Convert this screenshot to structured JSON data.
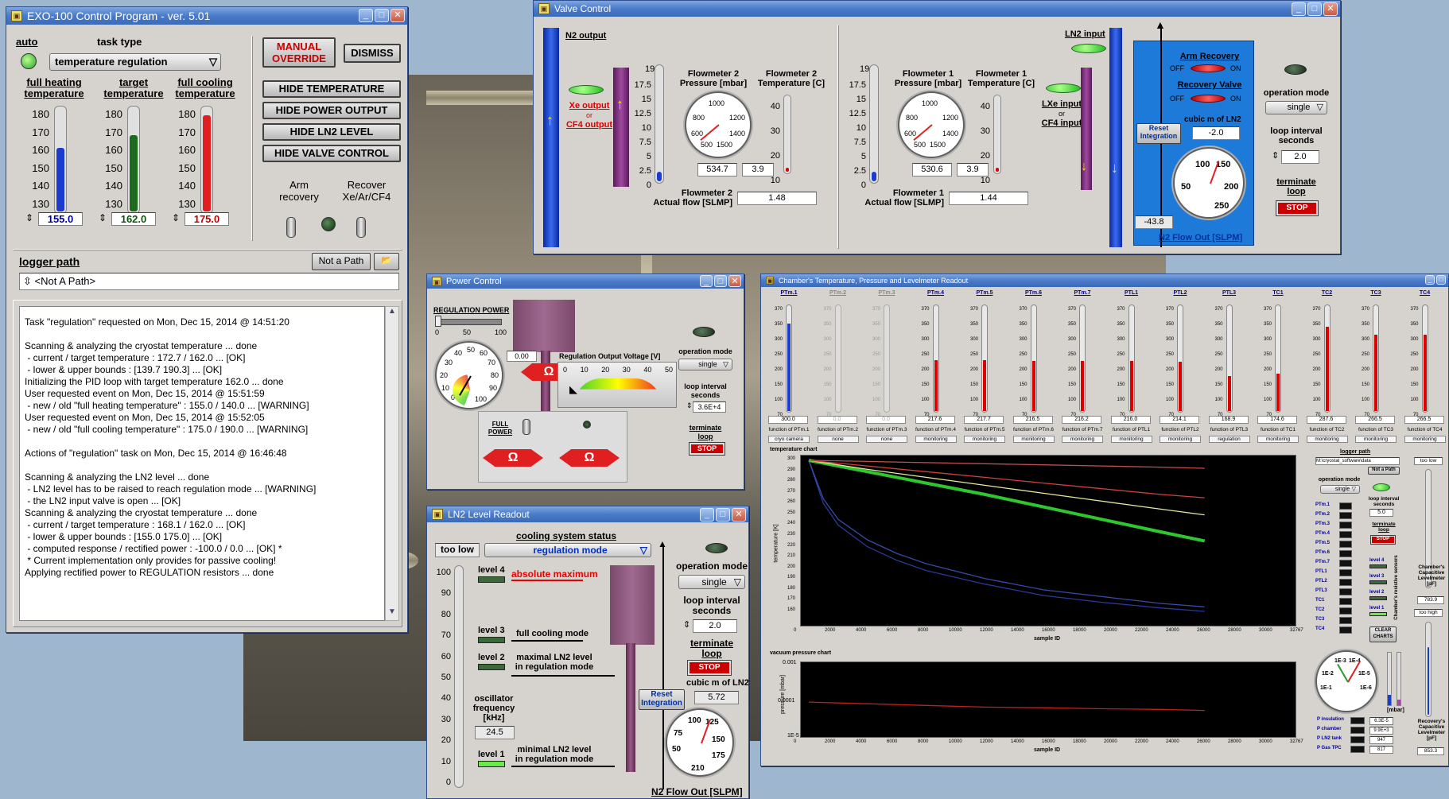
{
  "exo": {
    "title": "EXO-100 Control Program - ver. 5.01",
    "auto_label": "auto",
    "task_type_label": "task type",
    "task_type_value": "temperature regulation",
    "manual_override": "MANUAL\nOVERRIDE",
    "dismiss": "DISMISS",
    "hide_temperature": "HIDE TEMPERATURE",
    "hide_power": "HIDE POWER OUTPUT",
    "hide_ln2": "HIDE LN2 LEVEL",
    "hide_valve": "HIDE VALVE CONTROL",
    "full_heating_label": "full heating\ntemperature",
    "target_label": "target\ntemperature",
    "full_cooling_label": "full cooling\ntemperature",
    "scale": [
      "180",
      "170",
      "160",
      "150",
      "140",
      "130"
    ],
    "full_heating_value": "155.0",
    "target_value": "162.0",
    "full_cooling_value": "175.0",
    "arm_recovery": "Arm\nrecovery",
    "recover_label": "Recover\nXe/Ar/CF4",
    "logger_path_label": "logger path",
    "not_a_path_btn": "Not a Path",
    "logger_path_value": "<Not A Path>",
    "log": "Task \"regulation\" requested on Mon, Dec 15, 2014 @ 14:51:20\n\nScanning & analyzing the cryostat temperature ... done\n - current / target temperature : 172.7 / 162.0 ... [OK]\n - lower & upper bounds : [139.7 190.3] ... [OK]\nInitializing the PID loop with target temperature 162.0 ... done\nUser requested event on Mon, Dec 15, 2014 @ 15:51:59\n - new / old \"full heating temperature\" : 155.0 / 140.0 ... [WARNING]\nUser requested event on Mon, Dec 15, 2014 @ 15:52:05\n - new / old \"full cooling temperature\" : 175.0 / 190.0 ... [WARNING]\n\nActions of \"regulation\" task on Mon, Dec 15, 2014 @ 16:46:48\n\nScanning & analyzing the LN2 level ... done\n - LN2 level has to be raised to reach regulation mode ... [WARNING]\n - the LN2 input valve is open ... [OK]\nScanning & analyzing the cryostat temperature ... done\n - current / target temperature : 168.1 / 162.0 ... [OK]\n - lower & upper bounds : [155.0 175.0] ... [OK]\n - computed response / rectified power : -100.0 / 0.0 ... [OK] *\n * Current implementation only provides for passive cooling!\nApplying rectified power to REGULATION resistors ... done"
  },
  "valve": {
    "title": "Valve Control",
    "n2_output": "N2 output",
    "xe_output": "Xe output",
    "or": "or",
    "cf4_output": "CF4 output",
    "fm2_pressure": "Flowmeter 2\nPressure [mbar]",
    "fm2_temp": "Flowmeter 2\nTemperature [C]",
    "fm1_pressure": "Flowmeter 1\nPressure [mbar]",
    "fm1_temp": "Flowmeter 1\nTemperature [C]",
    "flow_scale": [
      "17.5",
      "15",
      "12.5",
      "10",
      "7.5",
      "5",
      "2.5",
      "0"
    ],
    "flow_scale_top": "19",
    "temp_scale": [
      "40",
      "30",
      "20",
      "10"
    ],
    "p_gauge_labels": [
      "1000",
      "800",
      "1200",
      "600",
      "1400",
      "500",
      "1500"
    ],
    "fm2_p_value": "534.7",
    "fm2_t_value": "3.9",
    "fm2_flow_label": "Flowmeter 2\nActual flow [SLMP]",
    "fm2_flow_value": "1.48",
    "fm1_p_value": "530.6",
    "fm1_t_value": "3.9",
    "fm1_flow_label": "Flowmeter 1\nActual flow [SLMP]",
    "fm1_flow_value": "1.44",
    "ln2_input": "LN2 input",
    "lxe_input": "LXe input",
    "cf4_input": "CF4 input",
    "arm_recovery": "Arm Recovery",
    "recovery_valve": "Recovery Valve",
    "off": "OFF",
    "on": "ON",
    "reset_integration": "Reset\nIntegration",
    "cubic_label": "cubic m of LN2",
    "cubic_value": "-2.0",
    "n2_gauge_labels": [
      "100",
      "150",
      "50",
      "200",
      "250"
    ],
    "n2_flow_value": "-43.8",
    "n2_flow_label": "N2 Flow Out [SLPM]",
    "operation_mode": "operation mode",
    "mode_value": "single",
    "loop_interval": "loop interval\nseconds",
    "loop_value": "2.0",
    "terminate": "terminate\nloop",
    "stop": "STOP"
  },
  "power": {
    "title": "Power Control",
    "regulation_power": "REGULATION POWER",
    "slider_scale": [
      "0",
      "50",
      "100"
    ],
    "slider_value": "0.00",
    "gauge_labels": [
      "40",
      "50",
      "60",
      "30",
      "70",
      "20",
      "80",
      "10",
      "90",
      "0",
      "100"
    ],
    "output_voltage": "Regulation Output Voltage [V]",
    "volt_scale": [
      "0",
      "10",
      "20",
      "30",
      "40",
      "50"
    ],
    "full_power": "FULL\nPOWER",
    "omega": "Ω",
    "operation_mode": "operation mode",
    "mode_value": "single",
    "loop_interval": "loop interval\nseconds",
    "loop_value": "3.6E+4",
    "terminate": "terminate\nloop",
    "stop": "STOP"
  },
  "ln2": {
    "title": "LN2 Level Readout",
    "cooling_status": "cooling system status",
    "too_low": "too low",
    "status_value": "regulation mode",
    "scale": [
      "100",
      "90",
      "80",
      "70",
      "60",
      "50",
      "40",
      "30",
      "20",
      "10",
      "0"
    ],
    "level4": "level 4",
    "level3": "level 3",
    "level2": "level 2",
    "level1": "level 1",
    "absolute_max": "absolute maximum",
    "full_cooling": "full cooling mode",
    "maximal": "maximal LN2 level\nin regulation mode",
    "minimal": "minimal LN2 level\nin regulation mode",
    "oscillator": "oscillator\nfrequency\n[kHz]",
    "osc_value": "24.5",
    "reset_integration": "Reset\nIntegration",
    "cubic_label": "cubic m of LN2",
    "cubic_value": "5.72",
    "gauge_labels": [
      "100",
      "125",
      "75",
      "150",
      "50",
      "175",
      "210"
    ],
    "n2_flow_label": "N2 Flow Out [SLPM]",
    "operation_mode": "operation mode",
    "mode_value": "single",
    "loop_interval": "loop interval\nseconds",
    "loop_value": "2.0",
    "terminate": "terminate\nloop",
    "stop": "STOP"
  },
  "chamber": {
    "title": "Chamber's Temperature, Pressure and Levelmeter Readout",
    "sensors": [
      {
        "name": "PTm.1",
        "value": "300.0",
        "fn": "function of PTm.1",
        "ring": "cryo camera",
        "level": 0.82,
        "color": "#1a3ad0"
      },
      {
        "name": "PTm.2",
        "value": "0.0",
        "fn": "function of PTm.2",
        "ring": "none",
        "level": 0.0,
        "color": "#c00"
      },
      {
        "name": "PTm.3",
        "value": "0.0",
        "fn": "function of PTm.3",
        "ring": "none",
        "level": 0.0,
        "color": "#c00"
      },
      {
        "name": "PTm.4",
        "value": "217.6",
        "fn": "function of PTm.4",
        "ring": "monitoring",
        "level": 0.48,
        "color": "#d00"
      },
      {
        "name": "PTm.5",
        "value": "217.7",
        "fn": "function of PTm.5",
        "ring": "monitoring",
        "level": 0.48,
        "color": "#d00"
      },
      {
        "name": "PTm.6",
        "value": "216.5",
        "fn": "function of PTm.6",
        "ring": "monitoring",
        "level": 0.47,
        "color": "#d00"
      },
      {
        "name": "PTm.7",
        "value": "216.2",
        "fn": "function of PTm.7",
        "ring": "monitoring",
        "level": 0.47,
        "color": "#d00"
      },
      {
        "name": "PTL1",
        "value": "216.0",
        "fn": "function of PTL1",
        "ring": "monitoring",
        "level": 0.47,
        "color": "#d00"
      },
      {
        "name": "PTL2",
        "value": "214.1",
        "fn": "function of PTL2",
        "ring": "monitoring",
        "level": 0.46,
        "color": "#d00"
      },
      {
        "name": "PTL3",
        "value": "168.9",
        "fn": "function of PTL3",
        "ring": "regulation",
        "level": 0.33,
        "color": "#d00"
      },
      {
        "name": "TC1",
        "value": "174.6",
        "fn": "function of TC1",
        "ring": "monitoring",
        "level": 0.35,
        "color": "#d00"
      },
      {
        "name": "TC2",
        "value": "287.6",
        "fn": "function of TC2",
        "ring": "monitoring",
        "level": 0.79,
        "color": "#d00"
      },
      {
        "name": "TC3",
        "value": "266.5",
        "fn": "function of TC3",
        "ring": "monitoring",
        "level": 0.72,
        "color": "#d00"
      },
      {
        "name": "TC4",
        "value": "266.5",
        "fn": "function of TC4",
        "ring": "monitoring",
        "level": 0.72,
        "color": "#d00"
      }
    ],
    "tscale": [
      "370",
      "350",
      "300",
      "250",
      "200",
      "150",
      "100",
      "70"
    ],
    "temp_chart_label": "temperature chart",
    "vac_chart_label": "vacuum pressure chart",
    "sample_id": "sample ID",
    "temperature_axis": "temperature [K]",
    "pressure_axis": "pressure [mbar]",
    "x_ticks": [
      "0",
      "2000",
      "4000",
      "6000",
      "8000",
      "10000",
      "12000",
      "14000",
      "16000",
      "18000",
      "20000",
      "22000",
      "24000",
      "26000",
      "28000",
      "30000",
      "32767"
    ],
    "y_ticks": [
      "300",
      "290",
      "280",
      "270",
      "260",
      "250",
      "240",
      "230",
      "220",
      "210",
      "200",
      "190",
      "180",
      "170",
      "160"
    ],
    "vac_y_ticks": [
      "0.001",
      "0.0001",
      "1E-5"
    ],
    "logger_path": "logger path",
    "logger_value": "M:\\cryostat_software\\data",
    "not_a_path": "Not a Path",
    "operation_mode": "operation mode",
    "mode_value": "single",
    "loop_interval": "loop interval\nseconds",
    "loop_value": "5.0",
    "terminate": "terminate\nloop",
    "stop": "STOP",
    "too_low": "too low",
    "too_high": "too high",
    "clear_charts": "CLEAR\nCHARTS",
    "legend": [
      "PTm.1",
      "PTm.2",
      "PTm.3",
      "PTm.4",
      "PTm.5",
      "PTm.6",
      "PTm.7",
      "PTL1",
      "PTL2",
      "PTL3",
      "TC1",
      "TC2",
      "TC3",
      "TC4"
    ],
    "levels": [
      "level 4",
      "level 3",
      "level 2",
      "level 1"
    ],
    "resist_label": "Chamber's resistive sensors",
    "capac_label": "Chamber's Capacitive Levelmeter [pF]",
    "capac_value": "783.9",
    "recov_label": "Recovery's Capacitive Levelmeter [pF]",
    "recov_value": "853.3",
    "pressures": [
      {
        "name": "P insulation",
        "value": "6.3E-5"
      },
      {
        "name": "P chamber",
        "value": "9.9E+3"
      },
      {
        "name": "P LN2 tank",
        "value": "947"
      },
      {
        "name": "P Gas TPC",
        "value": "817"
      }
    ],
    "mbar": "[mbar]",
    "mini_gauge_labels": [
      "1E-3",
      "1E-4",
      "1E-2",
      "1E-5",
      "1E-1",
      "1E-6"
    ]
  },
  "chart_data": [
    {
      "type": "line",
      "title": "temperature chart",
      "xlabel": "sample ID",
      "ylabel": "temperature [K]",
      "xlim": [
        0,
        32767
      ],
      "ylim": [
        160,
        300
      ],
      "series": [
        {
          "color": "#2a3a9a",
          "x": [
            0,
            1000,
            2000,
            4000,
            6000,
            8000,
            12000,
            16000,
            20000,
            24000,
            27000
          ],
          "y": [
            300,
            262,
            243,
            224,
            212,
            203,
            191,
            181,
            175,
            170,
            167
          ]
        },
        {
          "color": "#3a4aa8",
          "x": [
            0,
            1000,
            2000,
            4000,
            6000,
            8000,
            12000,
            16000,
            20000,
            24000,
            27000
          ],
          "y": [
            300,
            266,
            248,
            230,
            218,
            209,
            196,
            186,
            180,
            174,
            171
          ]
        },
        {
          "color": "#2ec82e",
          "x": [
            0,
            4000,
            8000,
            12000,
            16000,
            20000,
            24000,
            27000
          ],
          "y": [
            300,
            290,
            280,
            270,
            259,
            248,
            237,
            229
          ]
        },
        {
          "color": "#e8e8a0",
          "x": [
            0,
            4000,
            8000,
            12000,
            16000,
            20000,
            24000,
            27000
          ],
          "y": [
            300,
            292,
            285,
            278,
            271,
            264,
            257,
            252
          ]
        },
        {
          "color": "#d04040",
          "x": [
            0,
            4000,
            8000,
            12000,
            16000,
            20000,
            24000,
            27000
          ],
          "y": [
            300,
            295,
            290,
            285,
            280,
            275,
            270,
            267
          ]
        },
        {
          "color": "#c05050",
          "x": [
            0,
            4000,
            8000,
            12000,
            16000,
            20000,
            24000,
            27000
          ],
          "y": [
            300,
            299,
            298,
            297,
            296,
            295,
            294,
            293
          ]
        }
      ]
    },
    {
      "type": "line",
      "title": "vacuum pressure chart",
      "xlabel": "sample ID",
      "ylabel": "pressure [mbar]",
      "xlim": [
        0,
        32767
      ],
      "ylim_log": [
        -5,
        -3
      ],
      "series": [
        {
          "color": "#c02020",
          "x": [
            0,
            4000,
            8000,
            12000,
            16000,
            20000,
            24000,
            27000
          ],
          "y": [
            -4.05,
            -4.1,
            -4.15,
            -4.2,
            -4.22,
            -4.25,
            -4.27,
            -4.3
          ]
        }
      ]
    }
  ]
}
